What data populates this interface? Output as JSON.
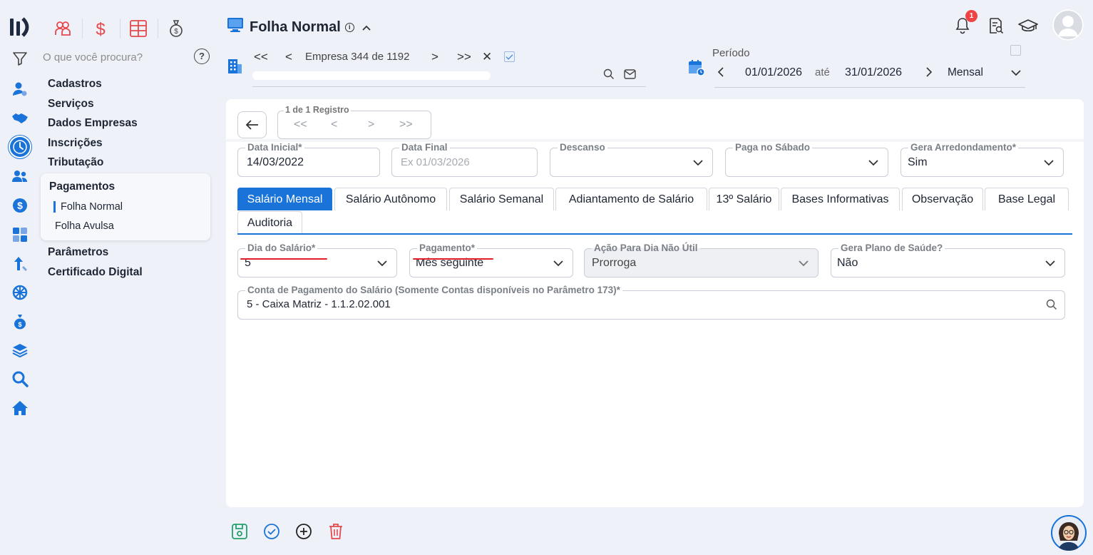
{
  "search": {
    "placeholder": "O que você procura?",
    "help": "?"
  },
  "menu": {
    "items_top": [
      "Cadastros",
      "Serviços",
      "Dados Empresas",
      "Inscrições",
      "Tributação"
    ],
    "group": {
      "title": "Pagamentos",
      "subitems": [
        "Folha Normal",
        "Folha Avulsa"
      ]
    },
    "items_bottom": [
      "Parâmetros",
      "Certificado Digital"
    ]
  },
  "header": {
    "title": "Folha Normal",
    "company_nav": {
      "first": "<<",
      "prev": "<",
      "label": "Empresa 344 de 1192",
      "next": ">",
      "last": ">>",
      "close": "✕"
    },
    "periodo": {
      "label": "Período",
      "start": "01/01/2026",
      "ate": "até",
      "end": "31/01/2026",
      "mode": "Mensal"
    },
    "notifications_count": "1"
  },
  "record": {
    "label": "1 de 1 Registro",
    "first": "<<",
    "prev": "<",
    "next": ">",
    "last": ">>"
  },
  "fields_row1": {
    "data_inicial": {
      "label": "Data Inicial*",
      "value": "14/03/2022"
    },
    "data_final": {
      "label": "Data Final",
      "placeholder": "Ex 01/03/2026"
    },
    "descanso": {
      "label": "Descanso",
      "value": ""
    },
    "paga_sabado": {
      "label": "Paga no Sábado",
      "value": ""
    },
    "gera_arredondamento": {
      "label": "Gera Arredondamento*",
      "value": "Sim"
    }
  },
  "tabs": [
    "Salário Mensal",
    "Salário Autônomo",
    "Salário Semanal",
    "Adiantamento de Salário",
    "13º Salário",
    "Bases Informativas",
    "Observação",
    "Base Legal",
    "Auditoria"
  ],
  "fields_row2": {
    "dia_salario": {
      "label": "Dia do Salário*",
      "value": "5"
    },
    "pagamento": {
      "label": "Pagamento*",
      "value": "Mês seguinte"
    },
    "acao_dia": {
      "label": "Ação Para Dia Não Útil",
      "value": "Prorroga"
    },
    "gera_plano": {
      "label": "Gera Plano de Saúde?",
      "value": "Não"
    }
  },
  "conta": {
    "label": "Conta de Pagamento do Salário (Somente Contas disponíveis no Parâmetro 173)*",
    "value": "5 - Caixa Matriz  - 1.1.2.02.001"
  },
  "colors": {
    "accent": "#1a73d9",
    "module_red": "#e5484d",
    "underline_red": "#e11d2a"
  }
}
